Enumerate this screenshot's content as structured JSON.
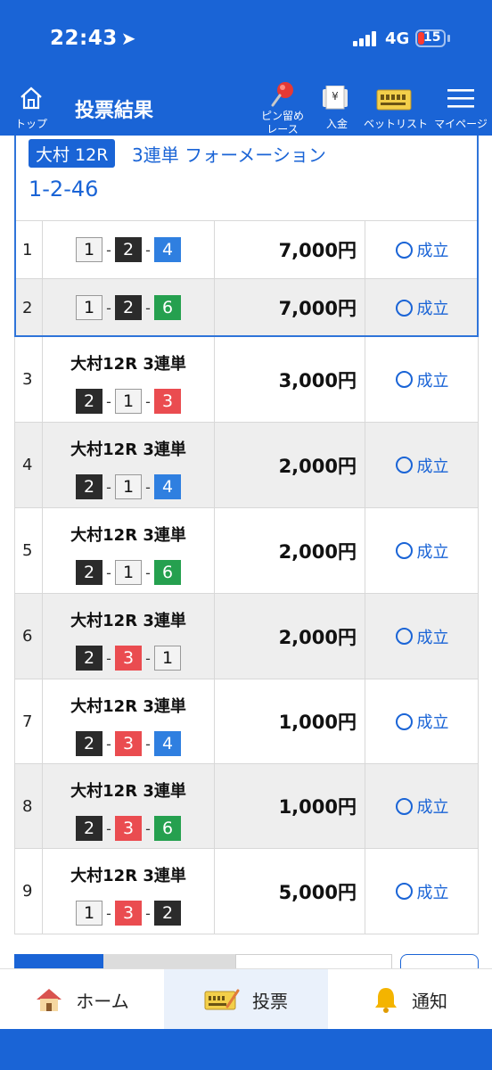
{
  "status": {
    "time": "22:43",
    "network": "4G",
    "battery": "15"
  },
  "header": {
    "title": "投票結果",
    "top_label": "トップ",
    "pin_label_1": "ピン留め",
    "pin_label_2": "レース",
    "deposit_label": "入金",
    "yen_symbol": "¥",
    "betlist_label": "ベットリスト",
    "mypage_label": "マイページ"
  },
  "formation": {
    "race": "大村 12R",
    "type": "3連単 フォーメーション",
    "numbers": "1-2-46"
  },
  "rows": [
    {
      "no": "1",
      "race": "",
      "combo": [
        "1",
        "2",
        "4"
      ],
      "amount": "7,000円",
      "status": "成立"
    },
    {
      "no": "2",
      "race": "",
      "combo": [
        "1",
        "2",
        "6"
      ],
      "amount": "7,000円",
      "status": "成立"
    },
    {
      "no": "3",
      "race": "大村12R 3連単",
      "combo": [
        "2",
        "1",
        "3"
      ],
      "amount": "3,000円",
      "status": "成立"
    },
    {
      "no": "4",
      "race": "大村12R 3連単",
      "combo": [
        "2",
        "1",
        "4"
      ],
      "amount": "2,000円",
      "status": "成立"
    },
    {
      "no": "5",
      "race": "大村12R 3連単",
      "combo": [
        "2",
        "1",
        "6"
      ],
      "amount": "2,000円",
      "status": "成立"
    },
    {
      "no": "6",
      "race": "大村12R 3連単",
      "combo": [
        "2",
        "3",
        "1"
      ],
      "amount": "2,000円",
      "status": "成立"
    },
    {
      "no": "7",
      "race": "大村12R 3連単",
      "combo": [
        "2",
        "3",
        "4"
      ],
      "amount": "1,000円",
      "status": "成立"
    },
    {
      "no": "8",
      "race": "大村12R 3連単",
      "combo": [
        "2",
        "3",
        "6"
      ],
      "amount": "1,000円",
      "status": "成立"
    },
    {
      "no": "9",
      "race": "大村12R 3連単",
      "combo": [
        "1",
        "3",
        "2"
      ],
      "amount": "5,000円",
      "status": "成立"
    }
  ],
  "nav": {
    "home": "ホーム",
    "vote": "投票",
    "notify": "通知"
  },
  "colors": {
    "primary": "#1a64d6",
    "boat1": "#f3f3f3",
    "boat2": "#2b2b2b",
    "boat3": "#ea4c50",
    "boat4": "#2f7fe0",
    "boat5": "#f2d21b",
    "boat6": "#25a04f"
  }
}
